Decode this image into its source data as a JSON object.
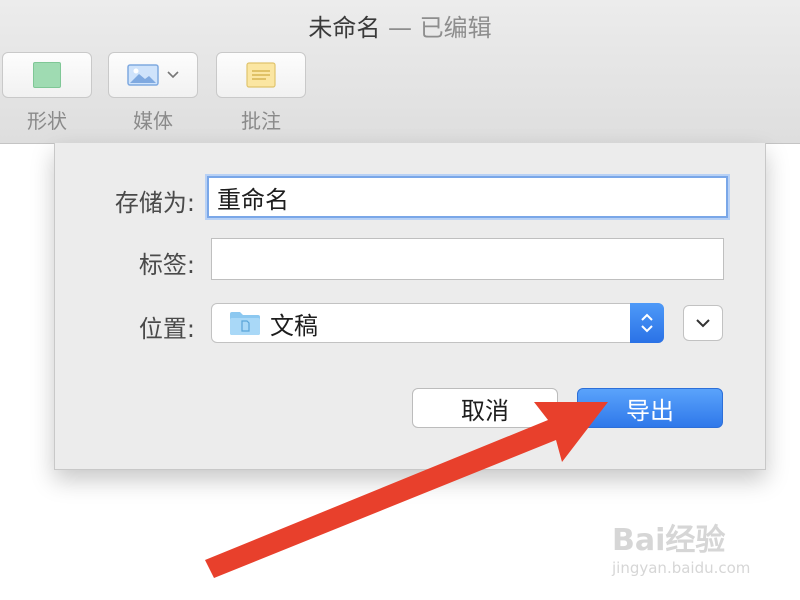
{
  "window": {
    "title": "未命名",
    "title_separator": "—",
    "title_status": "已编辑"
  },
  "toolbar": {
    "items": [
      {
        "label": "形状",
        "icon": "shape-icon"
      },
      {
        "label": "媒体",
        "icon": "media-icon"
      },
      {
        "label": "批注",
        "icon": "note-icon"
      }
    ]
  },
  "dialog": {
    "save_as_label": "存储为:",
    "save_as_value": "重命名",
    "tags_label": "标签:",
    "tags_value": "",
    "location_label": "位置:",
    "location_value": "文稿",
    "cancel_label": "取消",
    "export_label": "导出"
  },
  "watermark": {
    "brand": "Bai经验",
    "url": "jingyan.baidu.com"
  },
  "colors": {
    "accent": "#2f78ea",
    "annotation_arrow": "#e8402c"
  }
}
